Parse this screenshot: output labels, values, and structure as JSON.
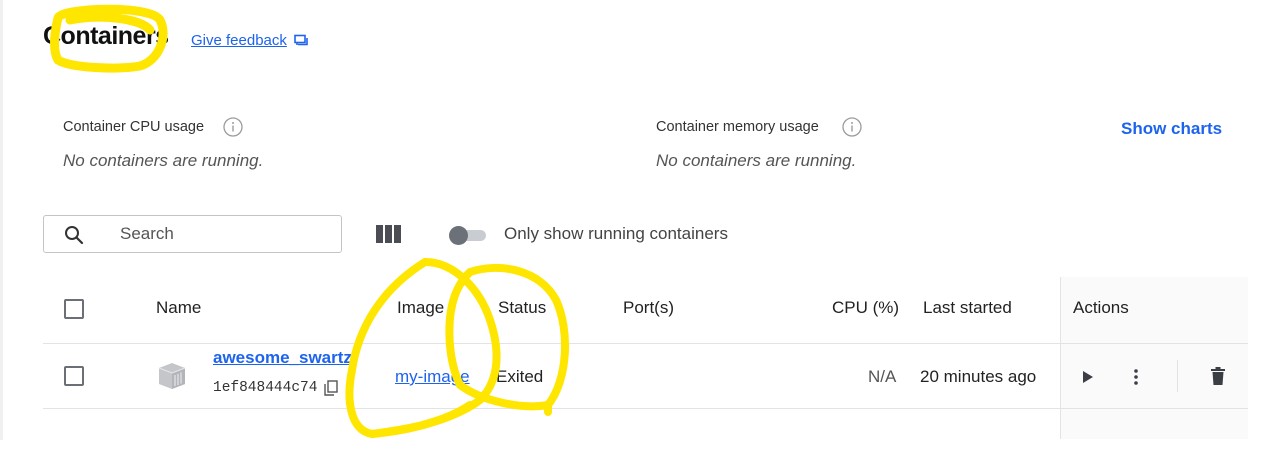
{
  "header": {
    "title": "Containers",
    "feedback_label": "Give feedback",
    "feedback_icon": "feedback-icon"
  },
  "stats": {
    "cpu_label": "Container CPU usage",
    "cpu_empty": "No containers are running.",
    "memory_label": "Container memory usage",
    "memory_empty": "No containers are running.",
    "show_charts_label": "Show charts"
  },
  "toolbar": {
    "search_placeholder": "Search",
    "toggle_label": "Only show running containers",
    "toggle_on": false
  },
  "table": {
    "columns": [
      "Name",
      "Image",
      "Status",
      "Port(s)",
      "CPU (%)",
      "Last started",
      "Actions"
    ],
    "rows": [
      {
        "name": "awesome_swartz",
        "id": "1ef848444c74",
        "image": "my-image",
        "status": "Exited",
        "ports": "",
        "cpu": "N/A",
        "last_started": "20 minutes ago"
      }
    ]
  },
  "colors": {
    "accent": "#1d63ed",
    "highlight": "#ffe600"
  }
}
